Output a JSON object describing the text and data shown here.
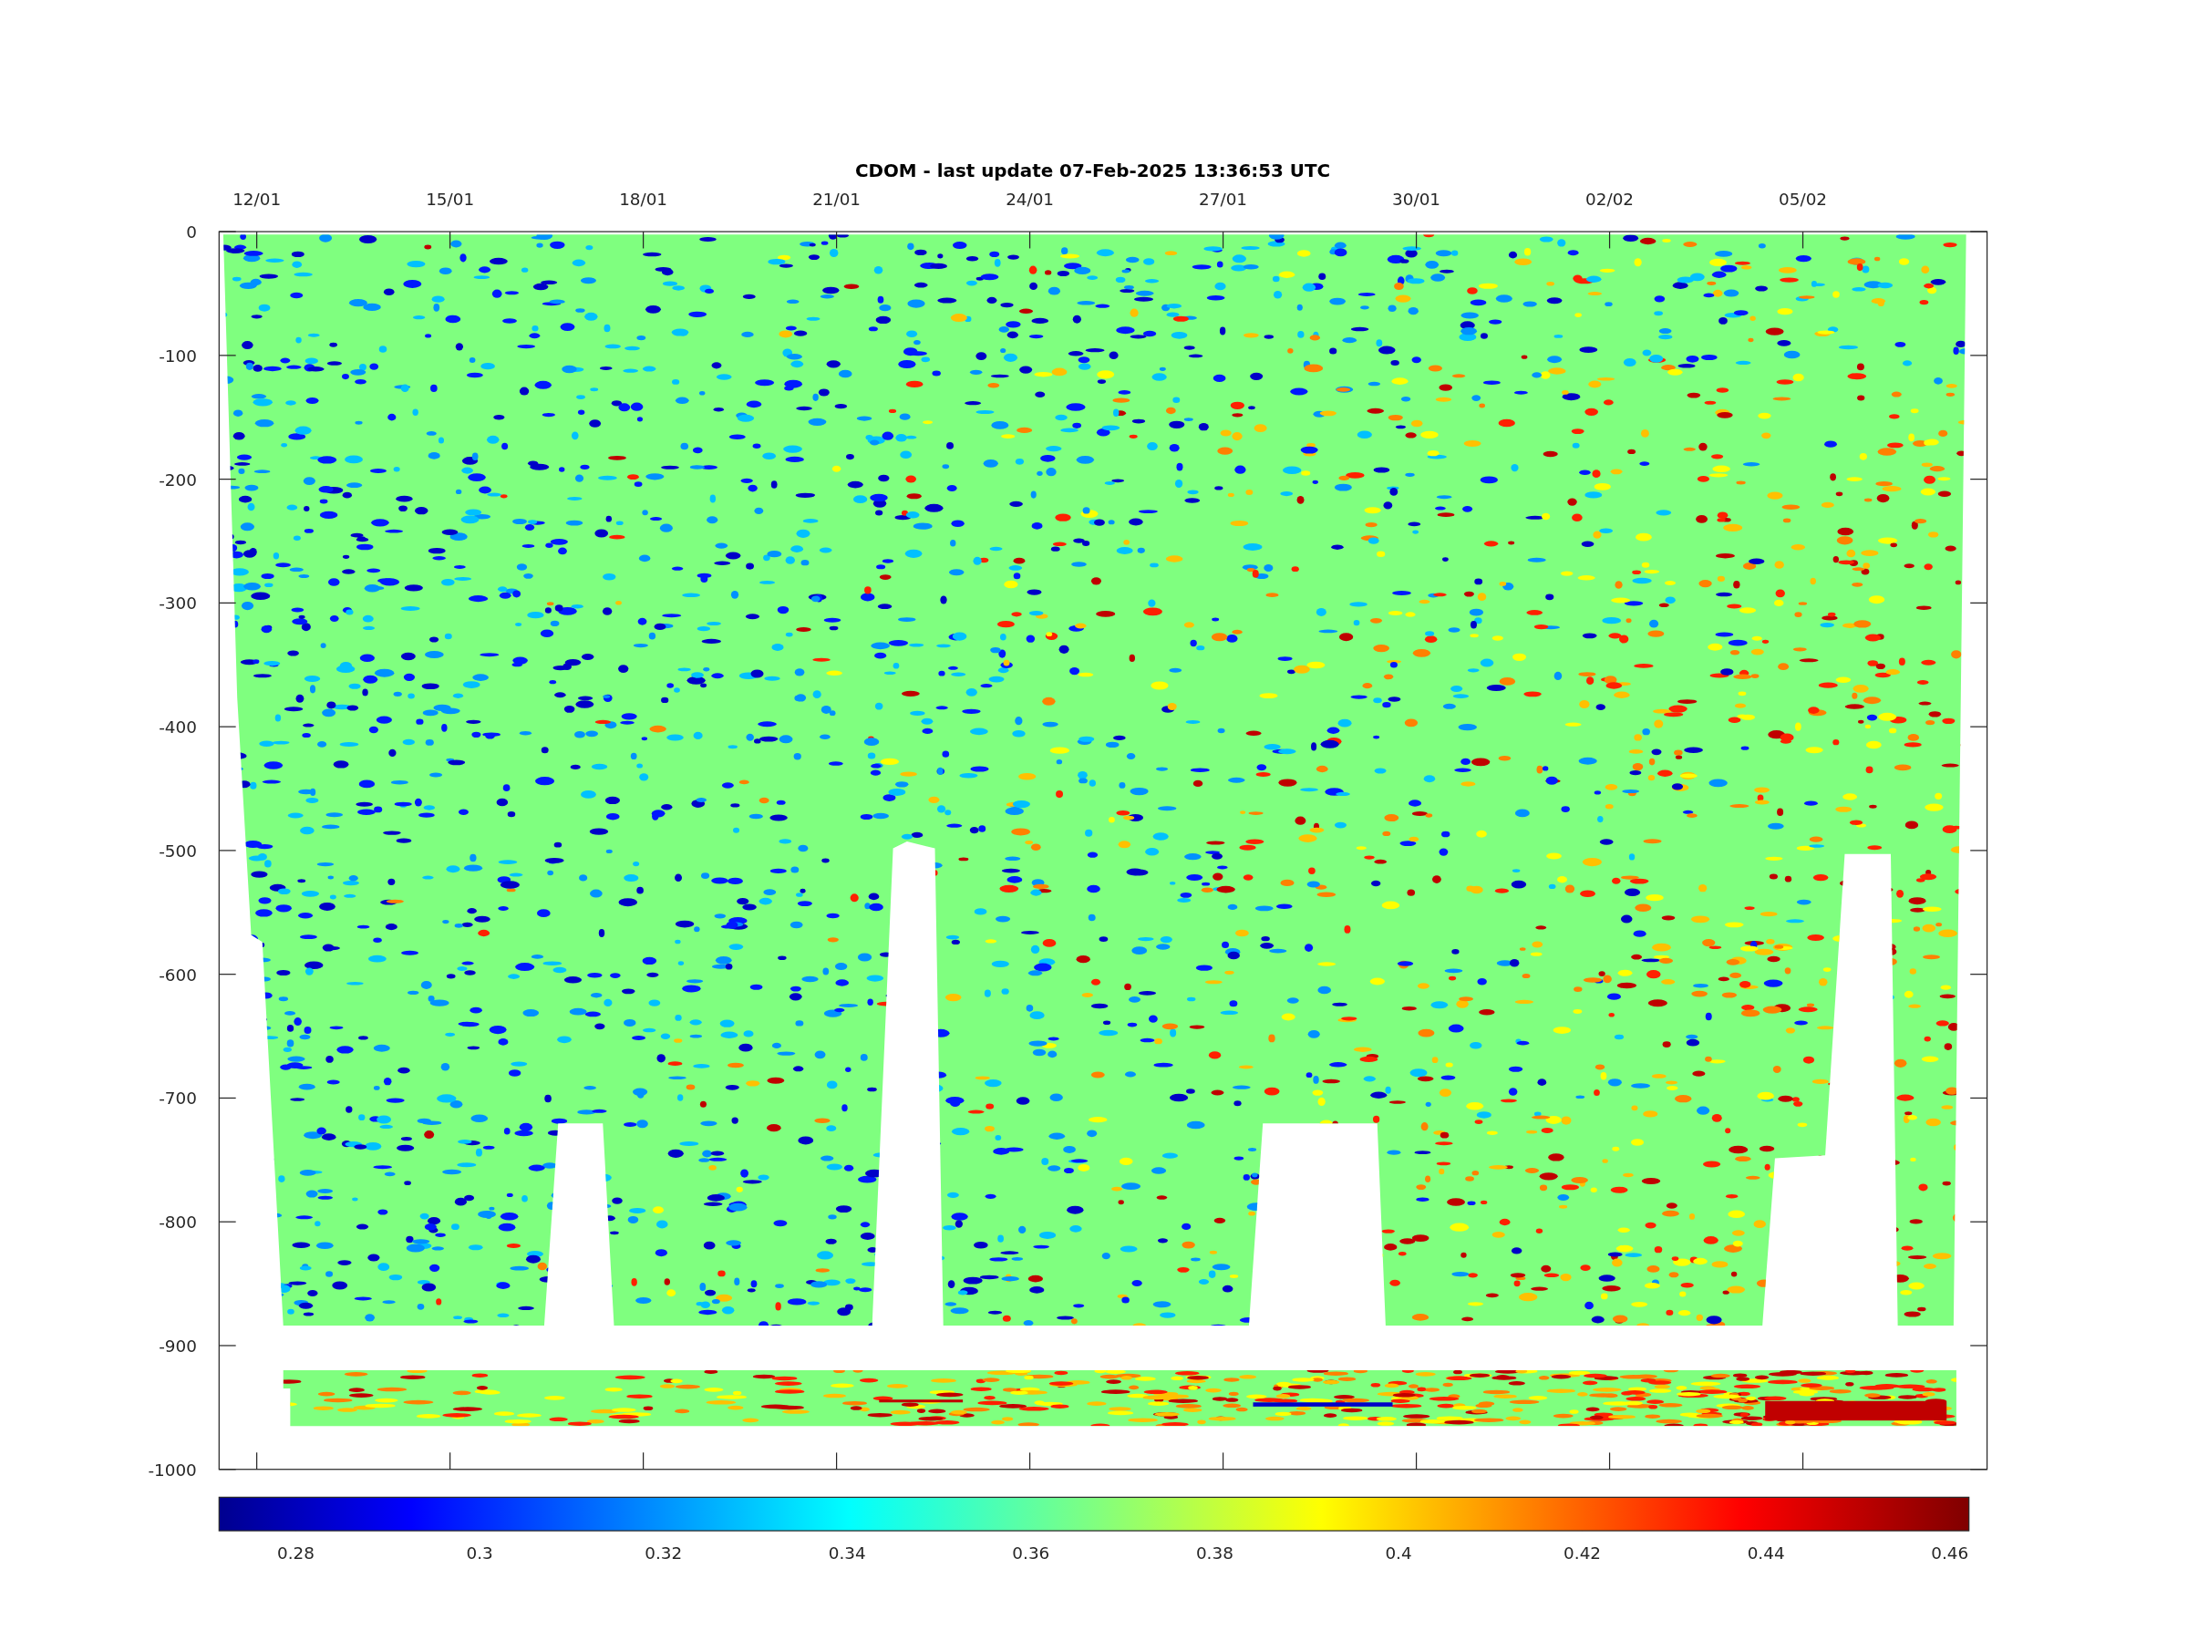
{
  "figure": {
    "title": "CDOM - last update 07-Feb-2025 13:36:53 UTC",
    "x_tick_labels": [
      "12/01",
      "15/01",
      "18/01",
      "21/01",
      "24/01",
      "27/01",
      "30/01",
      "02/02",
      "05/02"
    ],
    "y_tick_labels": [
      "0",
      "-100",
      "-200",
      "-300",
      "-400",
      "-500",
      "-600",
      "-700",
      "-800",
      "-900",
      "-1000"
    ],
    "colorbar": {
      "tick_labels": [
        "0.28",
        "0.3",
        "0.32",
        "0.34",
        "0.36",
        "0.38",
        "0.4",
        "0.42",
        "0.44",
        "0.46"
      ]
    }
  }
}
